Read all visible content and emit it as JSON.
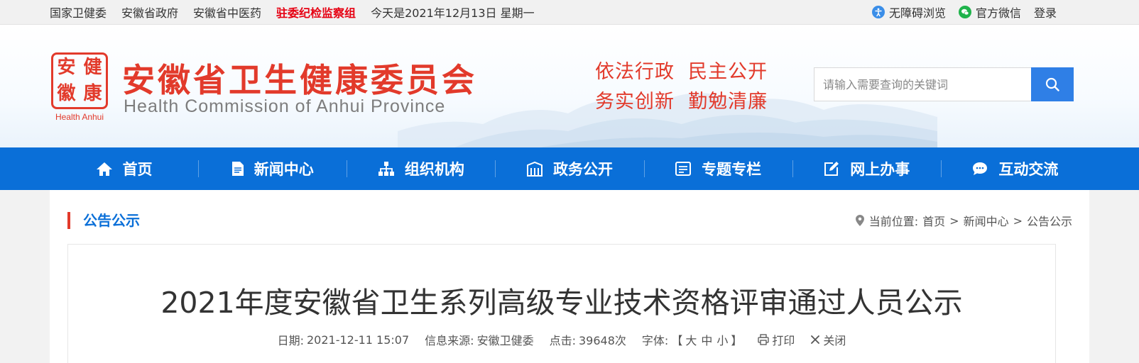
{
  "topbar": {
    "links": [
      "国家卫健委",
      "安徽省政府",
      "安徽省中医药"
    ],
    "highlight": "驻委纪检监察组",
    "date": "今天是2021年12月13日 星期一",
    "accessibility": "无障碍浏览",
    "wechat": "官方微信",
    "login": "登录"
  },
  "header": {
    "logo_chars": [
      "安",
      "健",
      "徽",
      "康"
    ],
    "logo_caption": "Health Anhui",
    "site_name": "安徽省卫生健康委员会",
    "site_name_en": "Health Commission of Anhui Province",
    "slogan_line1": "依法行政  民主公开",
    "slogan_line2": "务实创新  勤勉清廉",
    "search_placeholder": "请输入需要查询的关键词"
  },
  "nav": {
    "items": [
      {
        "label": "首页",
        "icon": "home-icon"
      },
      {
        "label": "新闻中心",
        "icon": "document-icon"
      },
      {
        "label": "组织机构",
        "icon": "org-chart-icon"
      },
      {
        "label": "政务公开",
        "icon": "building-icon"
      },
      {
        "label": "专题专栏",
        "icon": "list-box-icon"
      },
      {
        "label": "网上办事",
        "icon": "edit-icon"
      },
      {
        "label": "互动交流",
        "icon": "chat-icon"
      }
    ]
  },
  "page": {
    "section_title": "公告公示",
    "breadcrumb_label": "当前位置:",
    "breadcrumb": [
      "首页",
      "新闻中心",
      "公告公示"
    ],
    "breadcrumb_sep": ">",
    "article_title": "2021年度安徽省卫生系列高级专业技术资格评审通过人员公示",
    "meta": {
      "date_label": "日期:",
      "date": "2021-12-11 15:07",
      "source_label": "信息来源:",
      "source": "安徽卫健委",
      "hits_label": "点击:",
      "hits": "39648次",
      "font_label": "字体:",
      "bracket_open": "【",
      "font_sizes": [
        "大",
        "中",
        "小"
      ],
      "bracket_close": "】",
      "print": "打印",
      "close": "关闭"
    }
  },
  "colors": {
    "brand_red": "#e23a2b",
    "nav_blue": "#0a6fd8",
    "search_blue": "#2f7fe6"
  }
}
